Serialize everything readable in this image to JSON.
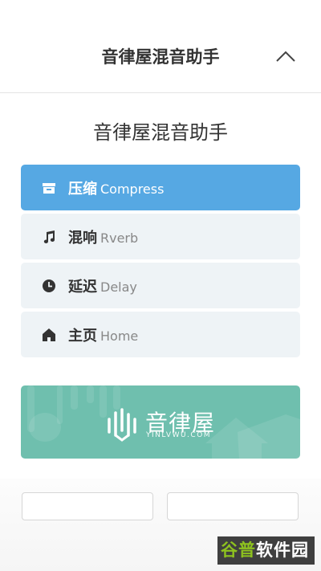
{
  "header": {
    "title": "音律屋混音助手",
    "collapse_icon": "chevron-up-icon"
  },
  "page": {
    "title": "音律屋混音助手"
  },
  "menu": {
    "items": [
      {
        "zh": "压缩",
        "en": "Compress",
        "icon": "archive-box-icon",
        "active": true
      },
      {
        "zh": "混响",
        "en": "Rverb",
        "icon": "music-note-icon",
        "active": false
      },
      {
        "zh": "延迟",
        "en": "Delay",
        "icon": "clock-icon",
        "active": false
      },
      {
        "zh": "主页",
        "en": "Home",
        "icon": "home-icon",
        "active": false
      }
    ]
  },
  "banner": {
    "name": "音律屋",
    "domain": "YINLVWU.COM",
    "logo_icon": "soundwave-logo-icon"
  },
  "watermark": {
    "part1": "谷普",
    "part2": "软件园"
  },
  "colors": {
    "accent": "#56a8e3",
    "banner": "#6fbfae",
    "item_bg": "#eef3f6",
    "watermark_green": "#8ec21f"
  }
}
